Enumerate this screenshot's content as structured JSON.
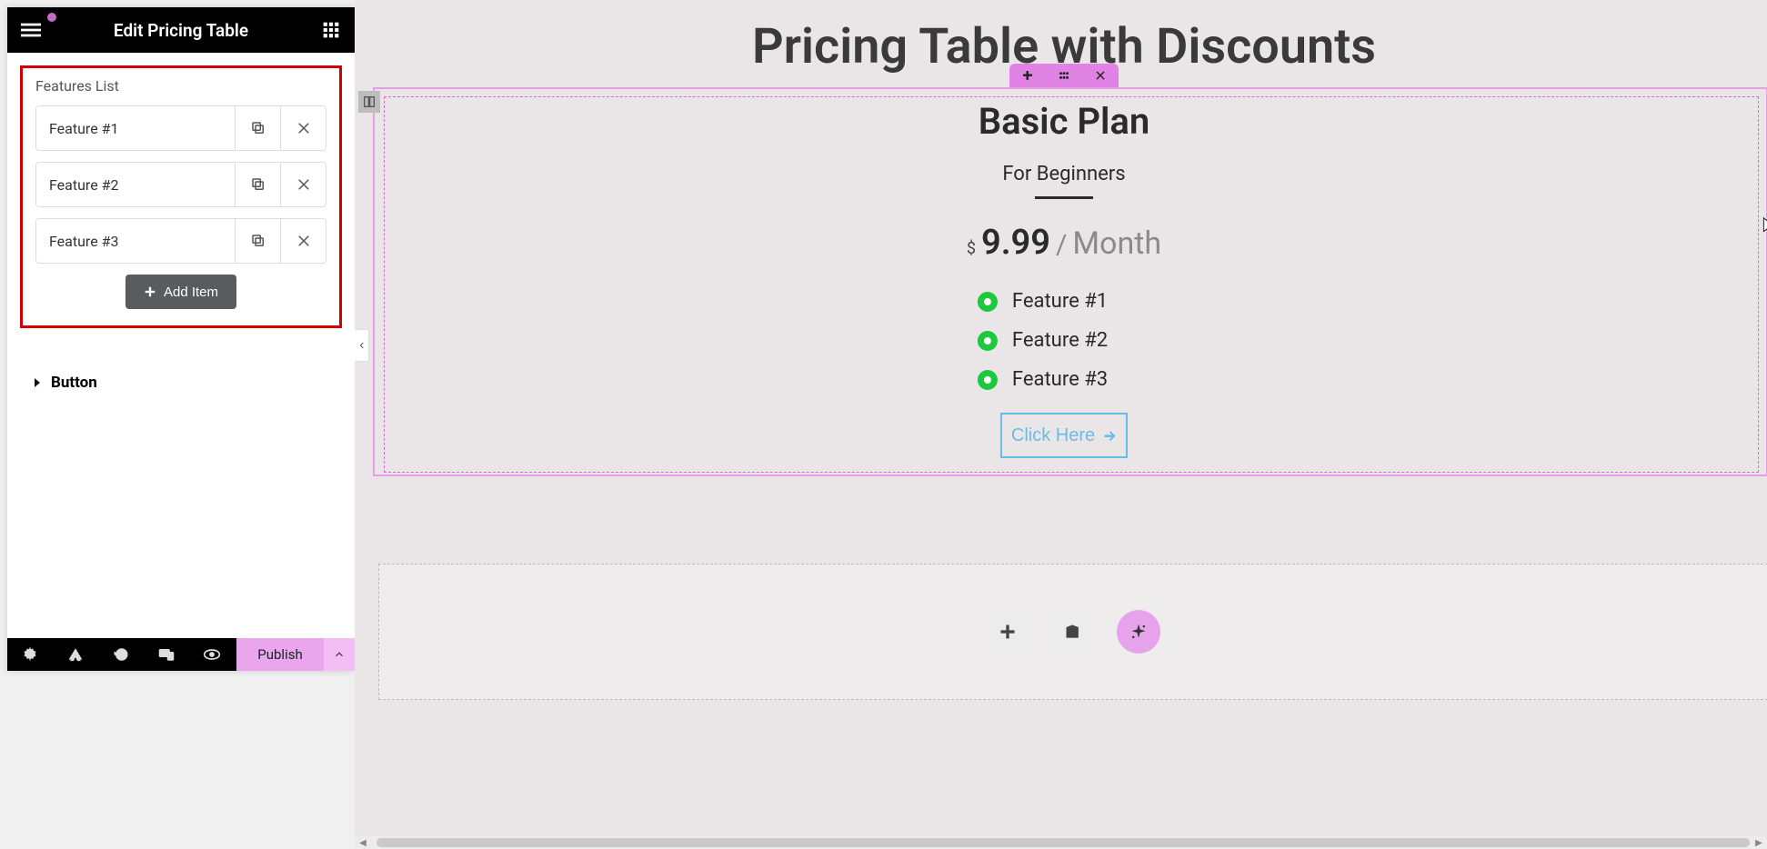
{
  "editor": {
    "title": "Edit Pricing Table",
    "features_label": "Features List",
    "features": [
      {
        "name": "Feature #1"
      },
      {
        "name": "Feature #2"
      },
      {
        "name": "Feature #3"
      }
    ],
    "add_item": "Add Item",
    "button_section": "Button",
    "footer": {
      "publish": "Publish"
    }
  },
  "page": {
    "title": "Pricing Table with Discounts",
    "plan": {
      "name": "Basic Plan",
      "subtitle": "For Beginners",
      "currency": "$",
      "price": "9.99",
      "sep": "/",
      "period": "Month",
      "features": [
        "Feature #1",
        "Feature #2",
        "Feature #3"
      ],
      "cta": "Click Here"
    }
  }
}
